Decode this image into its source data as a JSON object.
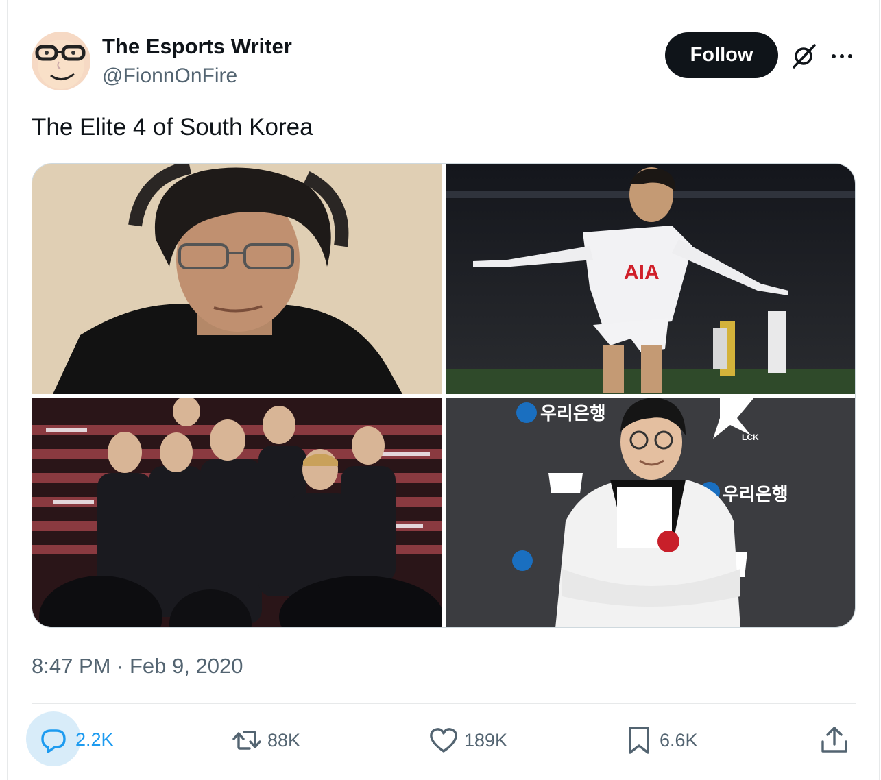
{
  "author": {
    "name": "The Esports Writer",
    "handle": "@FionnOnFire"
  },
  "header": {
    "follow_label": "Follow",
    "grok_icon": "grok-slash-icon",
    "more_icon": "more-dots-icon"
  },
  "tweet": {
    "text": "The Elite 4 of South Korea",
    "timestamp": "8:47 PM · Feb 9, 2020"
  },
  "media": {
    "photo4_sign_text_1": "우리은행",
    "photo4_sign_text_2": "LCK",
    "photo2_jersey_text": "AIA"
  },
  "actions": {
    "reply_count": "2.2K",
    "retweet_count": "88K",
    "like_count": "189K",
    "bookmark_count": "6.6K"
  },
  "colors": {
    "accent": "#1d9bf0",
    "secondary_text": "#536471",
    "primary_text": "#0f1419"
  }
}
